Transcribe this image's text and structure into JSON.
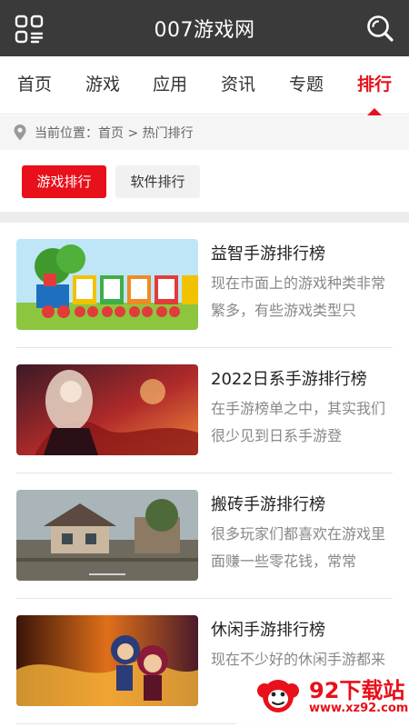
{
  "header": {
    "title": "007游戏网",
    "menu_icon": "grid-menu-icon",
    "search_icon": "search-icon"
  },
  "nav": {
    "items": [
      {
        "label": "首页"
      },
      {
        "label": "游戏"
      },
      {
        "label": "应用"
      },
      {
        "label": "资讯"
      },
      {
        "label": "专题"
      },
      {
        "label": "排行",
        "active": true
      }
    ]
  },
  "breadcrumb": {
    "icon": "location-pin-icon",
    "text": "当前位置：首页 > 热门排行"
  },
  "tabs": {
    "game_rank": "游戏排行",
    "software_rank": "软件排行",
    "active": "游戏排行"
  },
  "list": [
    {
      "title": "益智手游排行榜",
      "desc": "现在市面上的游戏种类非常繁多，有些游戏类型只"
    },
    {
      "title": "2022日系手游排行榜",
      "desc": "在手游榜单之中，其实我们很少见到日系手游登"
    },
    {
      "title": "搬砖手游排行榜",
      "desc": "很多玩家们都喜欢在游戏里面赚一些零花钱，常常"
    },
    {
      "title": "休闲手游排行榜",
      "desc": "现在不少好的休闲手游都来"
    }
  ],
  "watermark": {
    "name": "92下载站",
    "url": "www.xz92.com"
  },
  "colors": {
    "accent": "#e8101a",
    "header_bg": "#3a3a3a"
  }
}
